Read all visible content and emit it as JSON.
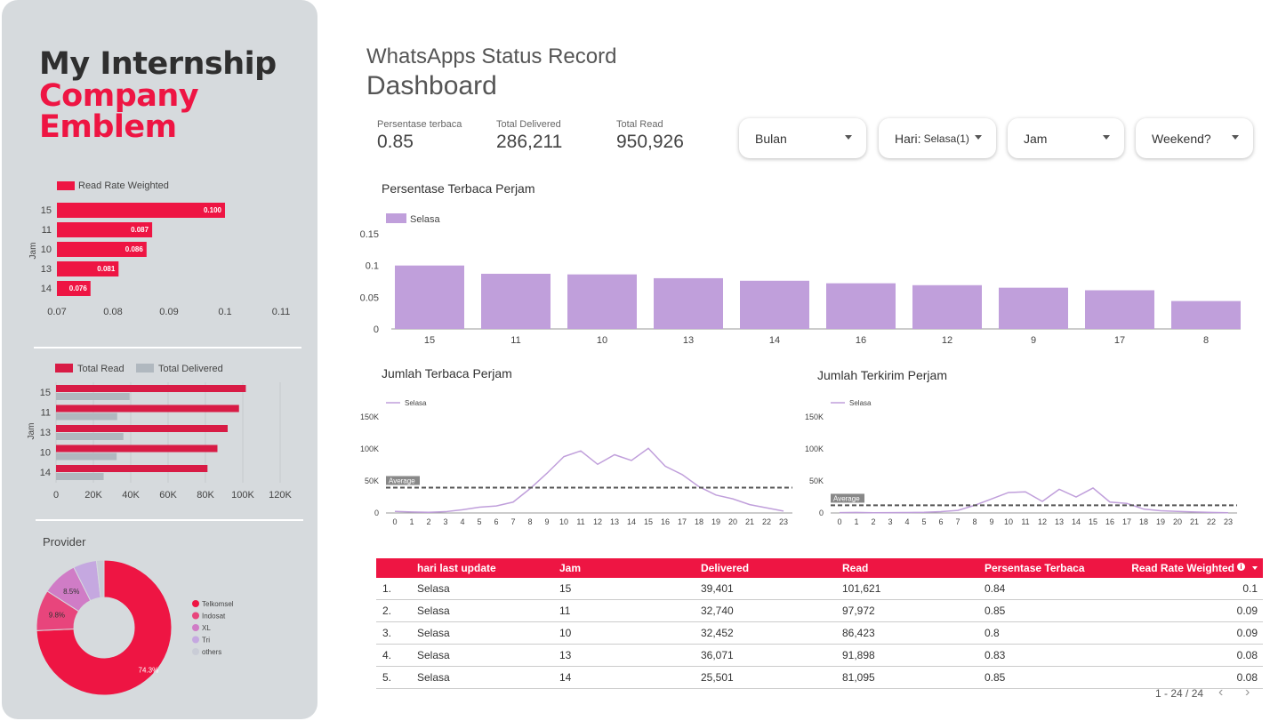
{
  "sidebar": {
    "brand_line1": "My Internship",
    "brand_line2": "Company",
    "brand_line3": "Emblem",
    "read_rate_chart": {
      "legend": "Read Rate Weighted",
      "ylabel": "Jam",
      "categories": [
        "15",
        "11",
        "10",
        "13",
        "14"
      ],
      "values": [
        0.1,
        0.087,
        0.086,
        0.081,
        0.076
      ],
      "value_labels": [
        "0.100",
        "0.087",
        "0.086",
        "0.081",
        "0.076"
      ],
      "xticks": [
        "0.07",
        "0.08",
        "0.09",
        "0.1",
        "0.11"
      ],
      "color": "#ee1543"
    },
    "read_delivered_chart": {
      "legend_read": "Total Read",
      "legend_delivered": "Total Delivered",
      "ylabel": "Jam",
      "categories": [
        "15",
        "11",
        "13",
        "10",
        "14"
      ],
      "read": [
        101621,
        97972,
        91898,
        86423,
        81095
      ],
      "delivered": [
        39401,
        32740,
        36071,
        32452,
        25501
      ],
      "xticks": [
        "0",
        "20K",
        "40K",
        "60K",
        "80K",
        "100K",
        "120K"
      ],
      "read_color": "#d81b45",
      "delivered_color": "#b0b8bf"
    },
    "provider_chart": {
      "title": "Provider",
      "labels": [
        "Telkomsel",
        "Indosat",
        "XL",
        "Tri",
        "others"
      ],
      "values": [
        74.3,
        9.8,
        8.5,
        5.6,
        1.8
      ],
      "value_labels": [
        "74.3%",
        "9.8%",
        "8.5%",
        "",
        ""
      ],
      "colors": [
        "#ee1543",
        "#e8457c",
        "#d07cc6",
        "#c5a8e0",
        "#c9ccd6"
      ]
    }
  },
  "header": {
    "title_small": "WhatsApps Status Record",
    "title_large": "Dashboard"
  },
  "kpis": [
    {
      "label": "Persentase terbaca",
      "value": "0.85"
    },
    {
      "label": "Total Delivered",
      "value": "286,211"
    },
    {
      "label": "Total Read",
      "value": "950,926"
    }
  ],
  "filters": {
    "bulan": "Bulan",
    "hari": "Hari:",
    "hari_value": "Selasa",
    "hari_count": "(1)",
    "jam": "Jam",
    "weekend": "Weekend?"
  },
  "chart_data": [
    {
      "type": "bar",
      "title": "Persentase Terbaca Perjam",
      "series": [
        {
          "name": "Selasa",
          "values": [
            0.1,
            0.087,
            0.086,
            0.08,
            0.076,
            0.072,
            0.069,
            0.065,
            0.061,
            0.044
          ]
        }
      ],
      "categories": [
        "15",
        "11",
        "10",
        "13",
        "14",
        "16",
        "12",
        "9",
        "17",
        "8"
      ],
      "yticks": [
        "0",
        "0.05",
        "0.1",
        "0.15"
      ],
      "ylim": [
        0,
        0.15
      ],
      "color": "#c09fdb"
    },
    {
      "type": "line",
      "title": "Jumlah Terbaca Perjam",
      "series": [
        {
          "name": "Selasa",
          "values": [
            2500,
            1500,
            1000,
            2000,
            5000,
            9000,
            11000,
            17000,
            38000,
            62000,
            88000,
            97000,
            76000,
            91000,
            82000,
            101000,
            73000,
            60000,
            41000,
            28000,
            22000,
            13000,
            8000,
            3000
          ]
        }
      ],
      "x": [
        "0",
        "1",
        "2",
        "3",
        "4",
        "5",
        "6",
        "7",
        "8",
        "9",
        "10",
        "11",
        "12",
        "13",
        "14",
        "15",
        "16",
        "17",
        "18",
        "19",
        "20",
        "21",
        "22",
        "23"
      ],
      "yticks": [
        "0",
        "50K",
        "100K",
        "150K"
      ],
      "ylim": [
        0,
        150000
      ],
      "average": 39600,
      "average_label": "Average",
      "color": "#c09fdb"
    },
    {
      "type": "line",
      "title": "Jumlah Terkirim Perjam",
      "series": [
        {
          "name": "Selasa",
          "values": [
            500,
            800,
            300,
            500,
            700,
            1000,
            2000,
            4000,
            12000,
            22000,
            32000,
            33000,
            18000,
            37000,
            25000,
            39000,
            17000,
            15000,
            6000,
            3500,
            2500,
            1500,
            800,
            300
          ]
        }
      ],
      "x": [
        "0",
        "1",
        "2",
        "3",
        "4",
        "5",
        "6",
        "7",
        "8",
        "9",
        "10",
        "11",
        "12",
        "13",
        "14",
        "15",
        "16",
        "17",
        "18",
        "19",
        "20",
        "21",
        "22",
        "23"
      ],
      "yticks": [
        "0",
        "50K",
        "100K",
        "150K"
      ],
      "ylim": [
        0,
        150000
      ],
      "average": 11900,
      "average_label": "Average",
      "color": "#c09fdb"
    }
  ],
  "table": {
    "columns": [
      "hari last update",
      "Jam",
      "Delivered",
      "Read",
      "Persentase Terbaca",
      "Read Rate Weighted"
    ],
    "rows": [
      {
        "n": "1.",
        "hari": "Selasa",
        "jam": "15",
        "delivered": "39,401",
        "read": "101,621",
        "persen": "0.84",
        "rate": "0.1"
      },
      {
        "n": "2.",
        "hari": "Selasa",
        "jam": "11",
        "delivered": "32,740",
        "read": "97,972",
        "persen": "0.85",
        "rate": "0.09"
      },
      {
        "n": "3.",
        "hari": "Selasa",
        "jam": "10",
        "delivered": "32,452",
        "read": "86,423",
        "persen": "0.8",
        "rate": "0.09"
      },
      {
        "n": "4.",
        "hari": "Selasa",
        "jam": "13",
        "delivered": "36,071",
        "read": "91,898",
        "persen": "0.83",
        "rate": "0.08"
      },
      {
        "n": "5.",
        "hari": "Selasa",
        "jam": "14",
        "delivered": "25,501",
        "read": "81,095",
        "persen": "0.85",
        "rate": "0.08"
      }
    ],
    "pagination": "1 - 24 / 24"
  }
}
